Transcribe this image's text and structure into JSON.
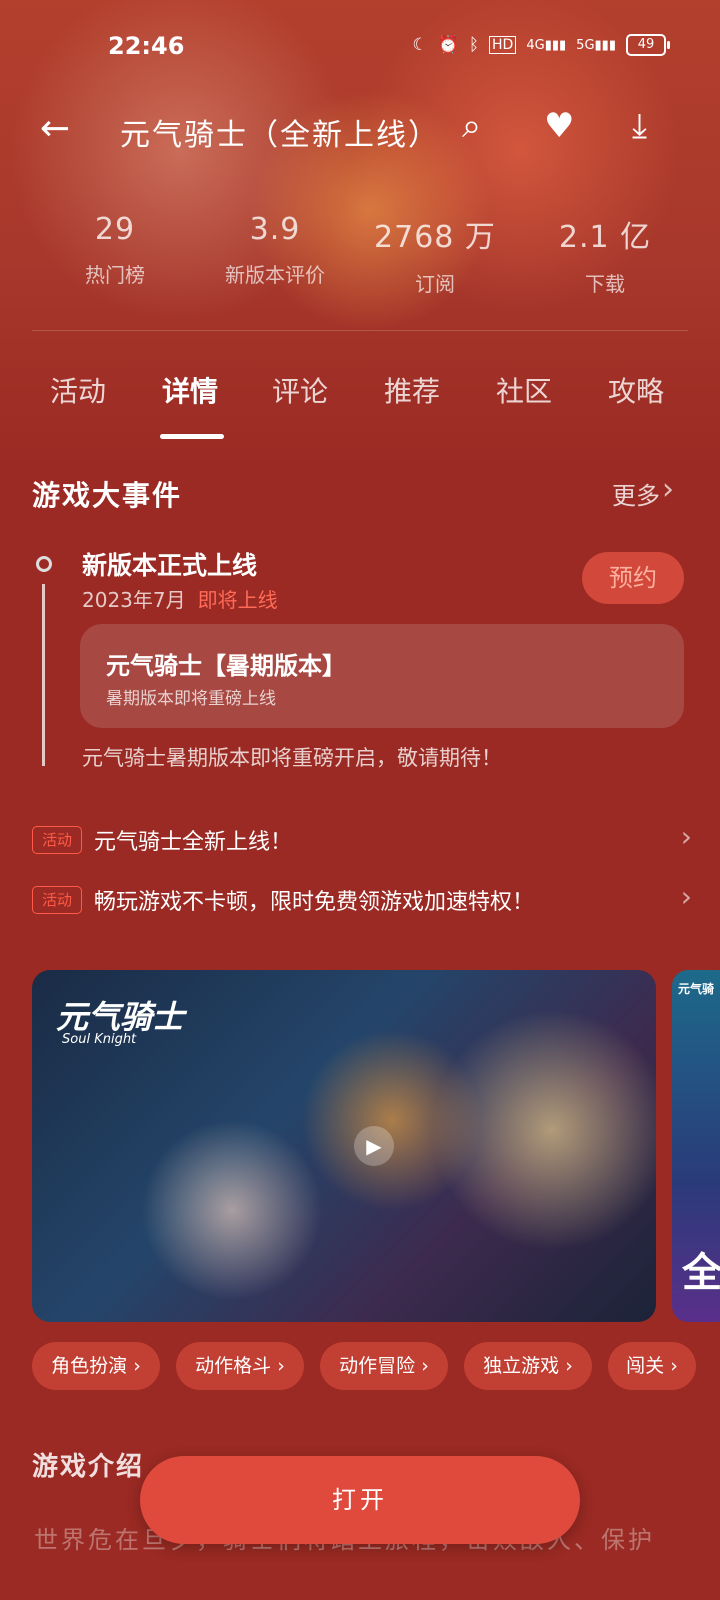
{
  "status_bar": {
    "time": "22:46",
    "icons": [
      "moon-icon",
      "alarm-icon",
      "bluetooth-icon",
      "hd-icon",
      "4g-signal-icon",
      "5g-signal-icon"
    ],
    "hd": "HD",
    "net1": "4G",
    "net2": "5G",
    "battery": "49"
  },
  "header": {
    "back_icon": "←",
    "title": "元气骑士（全新上线）",
    "search_icon": "⌕",
    "favorite_icon": "♥",
    "download_icon": "⤓"
  },
  "stats": [
    {
      "value": "29",
      "label": "热门榜"
    },
    {
      "value": "3.9",
      "label": "新版本评价"
    },
    {
      "value": "2768 万",
      "label": "订阅"
    },
    {
      "value": "2.1 亿",
      "label": "下载"
    }
  ],
  "tabs": [
    "活动",
    "详情",
    "评论",
    "推荐",
    "社区",
    "攻略"
  ],
  "events": {
    "section_title": "游戏大事件",
    "more_label": "更多",
    "item": {
      "title": "新版本正式上线",
      "date": "2023年7月",
      "status": "即将上线",
      "reserve_label": "预约",
      "card_title": "元气骑士【暑期版本】",
      "card_subtitle": "暑期版本即将重磅上线",
      "description": "元气骑士暑期版本即将重磅开启，敬请期待！"
    }
  },
  "promos": [
    {
      "badge": "活动",
      "text": "元气骑士全新上线！"
    },
    {
      "badge": "活动",
      "text": "畅玩游戏不卡顿，限时免费领游戏加速特权！"
    }
  ],
  "media": {
    "logo": "元气骑士",
    "logo_sub": "Soul Knight",
    "play_icon": "▶",
    "second_logo": "元气骑",
    "second_big": "全"
  },
  "tags": [
    "角色扮演 ›",
    "动作格斗 ›",
    "动作冒险 ›",
    "独立游戏 ›",
    "闯关 ›"
  ],
  "intro": {
    "title": "游戏介绍",
    "text": "世界危在旦夕，骑士们将踏上旅程，击败敌人、保护"
  },
  "open_button": "打开",
  "colors": {
    "accent": "#df4a3c",
    "background": "#9a2a23",
    "status_red": "#ff6b57"
  }
}
